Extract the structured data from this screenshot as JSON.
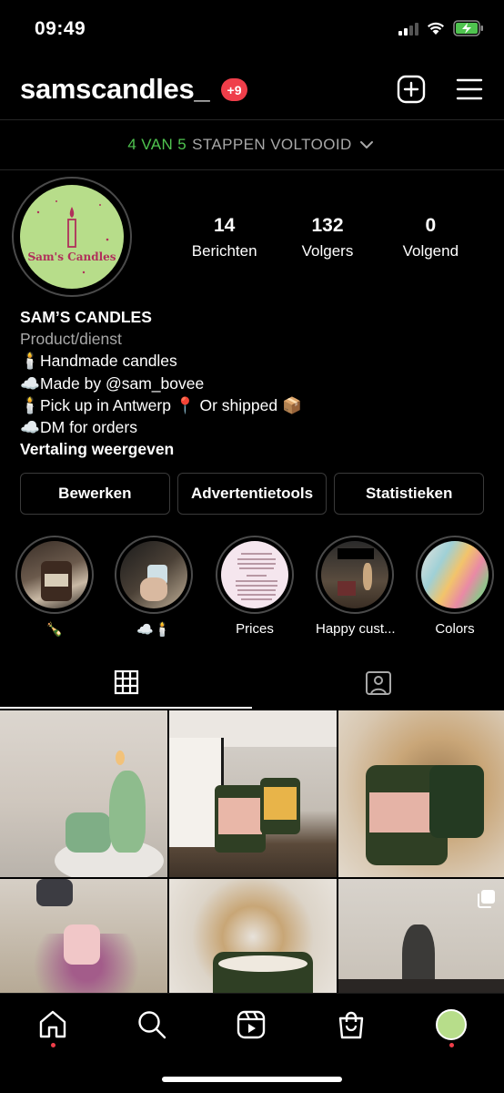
{
  "status_bar": {
    "time": "09:49"
  },
  "header": {
    "username": "samscandles_",
    "badge": "+9"
  },
  "setup": {
    "done": "4 VAN 5",
    "rest": "STAPPEN VOLTOOID"
  },
  "profile": {
    "avatar_text": "Sam's Candles",
    "stats": [
      {
        "value": "14",
        "label": "Berichten"
      },
      {
        "value": "132",
        "label": "Volgers"
      },
      {
        "value": "0",
        "label": "Volgend"
      }
    ],
    "name": "SAM’S CANDLES",
    "category": "Product/dienst",
    "bio_lines": [
      {
        "emoji": "🕯️",
        "text": "Handmade candles"
      },
      {
        "emoji": "☁️",
        "text": "Made by @sam_bovee"
      },
      {
        "emoji": "🕯️",
        "text": "Pick up in Antwerp 📍 Or shipped 📦"
      },
      {
        "emoji": "☁️",
        "text": "DM for orders"
      }
    ],
    "translate": "Vertaling weergeven"
  },
  "buttons": {
    "edit": "Bewerken",
    "ads": "Advertentietools",
    "stats": "Statistieken"
  },
  "highlights": [
    {
      "label": "🍾"
    },
    {
      "label": "☁️🕯️"
    },
    {
      "label": "Prices"
    },
    {
      "label": "Happy cust..."
    },
    {
      "label": "Colors"
    }
  ],
  "colors": {
    "accent_green": "#4fc34f",
    "badge_red": "#ef3e4a",
    "avatar_green": "#b7dd8a",
    "avatar_text": "#b0305b"
  }
}
